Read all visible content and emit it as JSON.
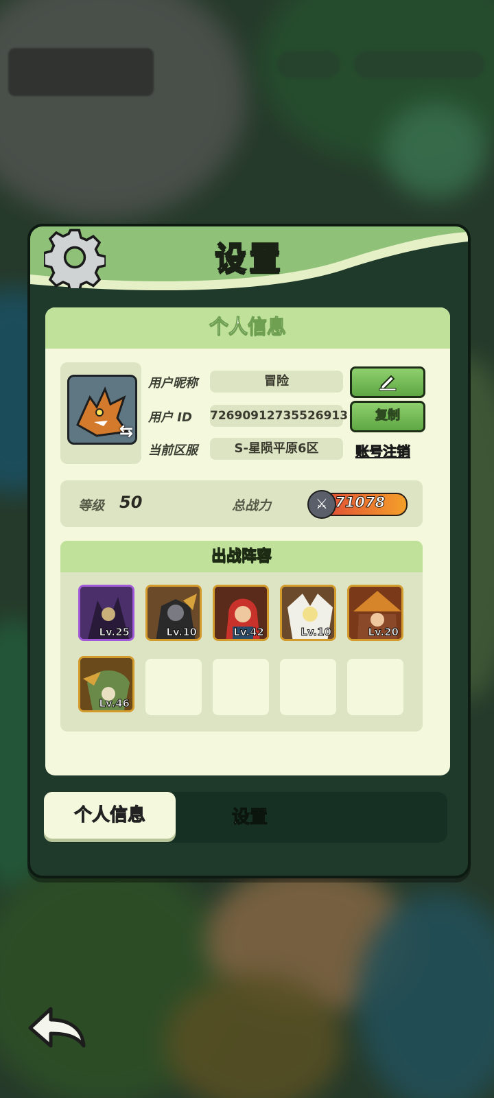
{
  "panel": {
    "title": "设置",
    "section_title": "个人信息"
  },
  "profile": {
    "nickname_label": "用户昵称",
    "nickname_value": "冒险",
    "id_label": "用户 ID",
    "id_value": "72690912735526913",
    "server_label": "当前区服",
    "server_value": "S-星陨平原6区",
    "copy_label": "复制",
    "cancel_account_label": "账号注销"
  },
  "stats": {
    "level_label": "等级",
    "level_value": "50",
    "power_label": "总战力",
    "power_value": "71078"
  },
  "lineup": {
    "title": "出战阵容",
    "heroes": [
      {
        "level": "Lv.25",
        "rarity": "purple"
      },
      {
        "level": "Lv.10",
        "rarity": "gold"
      },
      {
        "level": "Lv.42",
        "rarity": "gold"
      },
      {
        "level": "Lv.10",
        "rarity": "gold"
      },
      {
        "level": "Lv.20",
        "rarity": "gold"
      },
      {
        "level": "Lv.46",
        "rarity": "gold"
      }
    ],
    "empty_slots": 4
  },
  "tabs": {
    "profile": "个人信息",
    "settings": "设置"
  },
  "icons": {
    "header": "gear-icon",
    "edit": "pencil-icon",
    "swap": "swap-icon",
    "power": "crossed-swords-icon",
    "back": "back-arrow-icon"
  },
  "colors": {
    "accent_green": "#8ed06d",
    "panel_dark": "#1f3a2a",
    "content_bg": "#f4f8dc",
    "header_green": "#bfe19a"
  }
}
